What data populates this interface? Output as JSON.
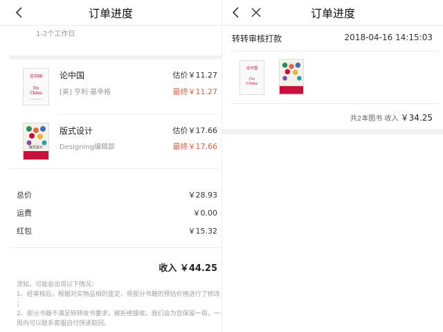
{
  "left": {
    "nav_title": "订单进度",
    "processing_time": "1-2个工作日",
    "books": [
      {
        "title": "论中国",
        "author": "[美] 亨利·基辛格",
        "estimate": "估价￥11.27",
        "final": "最终￥11.27",
        "cover": {
          "cn": "论中国",
          "en_line1": "On",
          "en_line2": "China"
        }
      },
      {
        "title": "版式设计",
        "author": "Designing编辑部",
        "estimate": "估价￥17.66",
        "final": "最终￥17.66",
        "cover": {
          "cn": "版式设计"
        }
      }
    ],
    "totals": [
      {
        "label": "总价",
        "value": "￥28.93"
      },
      {
        "label": "运费",
        "value": "￥0.00"
      },
      {
        "label": "红包",
        "value": "￥15.32"
      }
    ],
    "income": "收入 ￥44.25",
    "notes": [
      "须知，可能会出现以下情况：",
      "1、经审核后，根据对实物品相的鉴定，将部分书籍的预估价格进行了修改 ；",
      "2、部分书籍不满足转转收书要求，被拒绝接收。我们会为您保留一周，一周内可以联系客服自付快递取回。"
    ]
  },
  "right": {
    "nav_title": "订单进度",
    "status": "转转审核打款",
    "timestamp": "2018-04-16 14:15:03",
    "summary_prefix": "共2本图书 收入",
    "summary_amount": "￥34.25"
  },
  "colors": {
    "price_final": "#e0613f",
    "divider": "#ebebeb",
    "gap": "#f2f2f2",
    "cover_red": "#c8103a"
  },
  "icons": [
    "back-chevron-icon",
    "close-x-icon"
  ]
}
